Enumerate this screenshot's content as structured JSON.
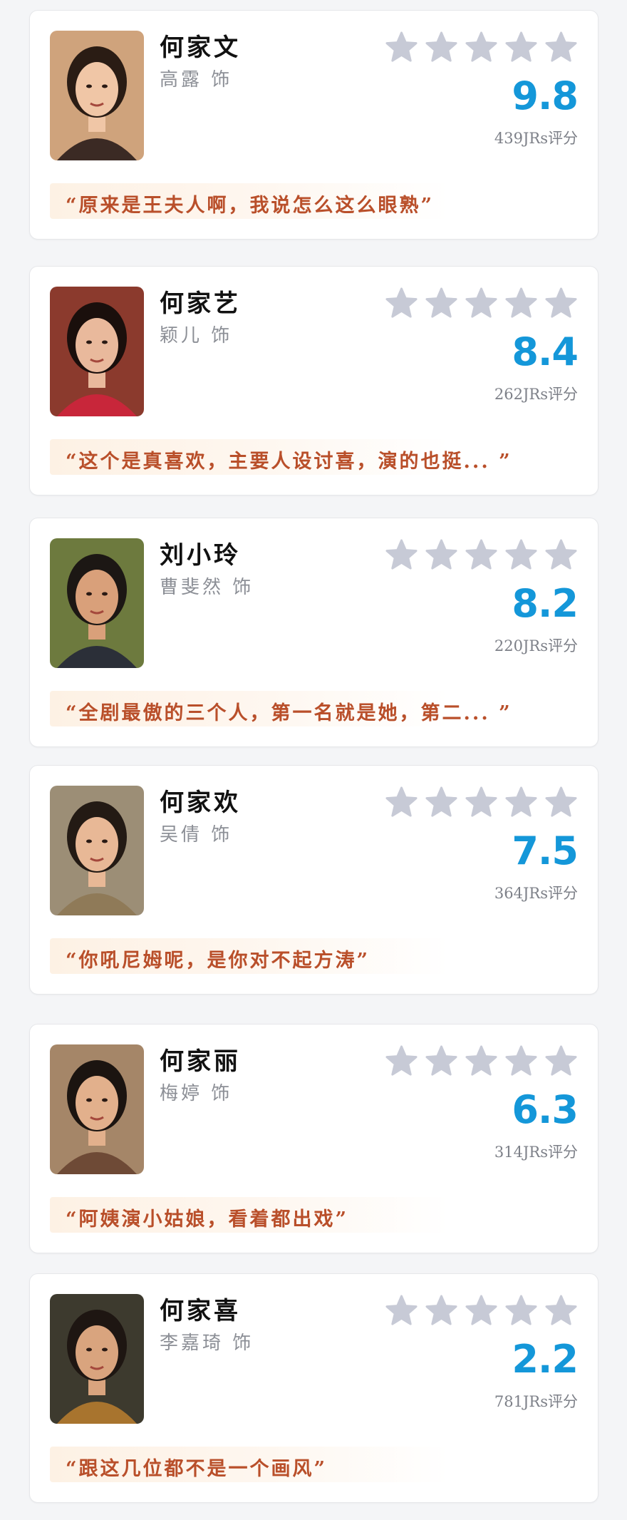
{
  "cards": [
    {
      "name": "何家文",
      "actor": "高露 饰",
      "score": "9.8",
      "count": "439JRs评分",
      "quote": "“原来是王夫人啊，我说怎么这么眼熟”",
      "stars": [
        "star-icon",
        "star-icon",
        "star-icon",
        "star-icon",
        "star-icon"
      ],
      "colors": {
        "bg": "#cfa37c",
        "hair": "#2a1c14",
        "skin": "#f0c6a6",
        "clothes": "#3b2a24"
      }
    },
    {
      "name": "何家艺",
      "actor": "颖儿 饰",
      "score": "8.4",
      "count": "262JRs评分",
      "quote": "“这个是真喜欢，主要人设讨喜，演的也挺... ”",
      "stars": [
        "star-icon",
        "star-icon",
        "star-icon",
        "star-icon",
        "star-icon"
      ],
      "colors": {
        "bg": "#8b3a2d",
        "hair": "#1a0f0c",
        "skin": "#e9b99c",
        "clothes": "#c8263a"
      }
    },
    {
      "name": "刘小玲",
      "actor": "曹斐然 饰",
      "score": "8.2",
      "count": "220JRs评分",
      "quote": "“全剧最傲的三个人，第一名就是她，第二... ”",
      "stars": [
        "star-icon",
        "star-icon",
        "star-icon",
        "star-icon",
        "star-icon"
      ],
      "colors": {
        "bg": "#6d7a3e",
        "hair": "#1c1714",
        "skin": "#d9a07a",
        "clothes": "#2b2f38"
      }
    },
    {
      "name": "何家欢",
      "actor": "吴倩 饰",
      "score": "7.5",
      "count": "364JRs评分",
      "quote": "“你吼尼姆呢，是你对不起方涛”",
      "stars": [
        "star-icon",
        "star-icon",
        "star-icon",
        "star-icon",
        "star-icon"
      ],
      "colors": {
        "bg": "#9c8e76",
        "hair": "#231a14",
        "skin": "#e8b896",
        "clothes": "#8f7a58"
      }
    },
    {
      "name": "何家丽",
      "actor": "梅婷 饰",
      "score": "6.3",
      "count": "314JRs评分",
      "quote": "“阿姨演小姑娘，看着都出戏”",
      "stars": [
        "star-icon",
        "star-icon",
        "star-icon",
        "star-icon",
        "star-icon"
      ],
      "colors": {
        "bg": "#a58668",
        "hair": "#1b1410",
        "skin": "#e2b08c",
        "clothes": "#6e4a36"
      }
    },
    {
      "name": "何家喜",
      "actor": "李嘉琦 饰",
      "score": "2.2",
      "count": "781JRs评分",
      "quote": "“跟这几位都不是一个画风”",
      "stars": [
        "star-icon",
        "star-icon",
        "star-icon",
        "star-icon",
        "star-icon"
      ],
      "colors": {
        "bg": "#3d3a2e",
        "hair": "#1e1612",
        "skin": "#d9a47e",
        "clothes": "#a8742e"
      }
    }
  ],
  "theme": {
    "star": "#c7cad6",
    "score": "#1497d9",
    "quote": "#b94f2a"
  }
}
